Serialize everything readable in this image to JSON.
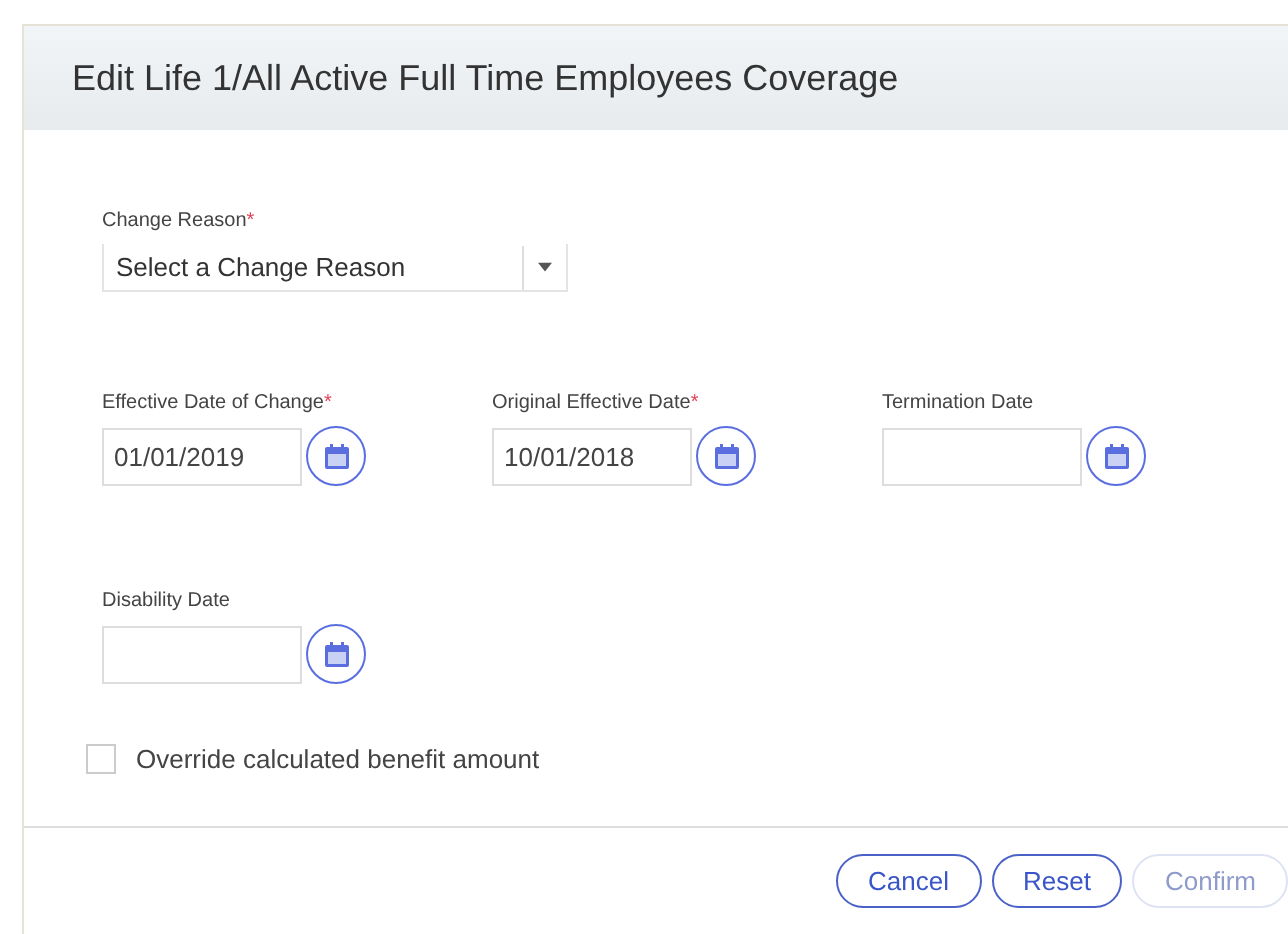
{
  "dialog": {
    "title": "Edit Life 1/All Active Full Time Employees Coverage"
  },
  "change_reason": {
    "label": "Change Reason",
    "required_mark": "*",
    "placeholder": "Select a Change Reason"
  },
  "date_fields": [
    {
      "label": "Effective Date of Change",
      "required_mark": "*",
      "value": "01/01/2019"
    },
    {
      "label": "Original Effective Date",
      "required_mark": "*",
      "value": "10/01/2018"
    },
    {
      "label": "Termination Date"
    },
    {
      "label": "Disability Date"
    }
  ],
  "override": {
    "label": "Override calculated benefit amount",
    "checked": false
  },
  "buttons": [
    {
      "label": "Cancel",
      "disabled": false
    },
    {
      "label": "Reset",
      "disabled": false
    },
    {
      "label": "Confirm",
      "disabled": true
    }
  ]
}
